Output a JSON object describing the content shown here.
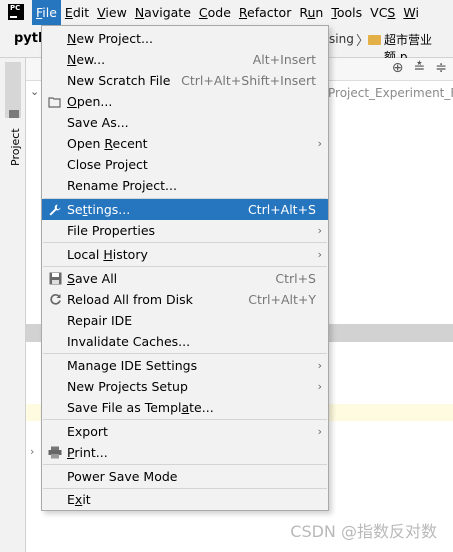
{
  "app_icon_text": "PC",
  "menubar": {
    "items": [
      {
        "pre": "",
        "u": "F",
        "post": "ile"
      },
      {
        "pre": "",
        "u": "E",
        "post": "dit"
      },
      {
        "pre": "",
        "u": "V",
        "post": "iew"
      },
      {
        "pre": "",
        "u": "N",
        "post": "avigate"
      },
      {
        "pre": "",
        "u": "C",
        "post": "ode"
      },
      {
        "pre": "",
        "u": "R",
        "post": "efactor"
      },
      {
        "pre": "R",
        "u": "u",
        "post": "n"
      },
      {
        "pre": "",
        "u": "T",
        "post": "ools"
      },
      {
        "pre": "VC",
        "u": "S",
        "post": ""
      },
      {
        "pre": "",
        "u": "W",
        "post": "i"
      }
    ]
  },
  "background": {
    "project_name": "pyth",
    "breadcrumb_fragment": "sing",
    "breadcrumb_folder": "超市营业额.p",
    "tree_path_tail": "Project_Experiment_Fir",
    "project_tab_label": "Project",
    "watermark": "CSDN @指数反对数"
  },
  "file_menu": {
    "items": [
      {
        "pre": "",
        "u": "N",
        "post": "ew Project...",
        "shortcut": "",
        "icon": ""
      },
      {
        "pre": "",
        "u": "N",
        "post": "ew...",
        "shortcut": "Alt+Insert",
        "icon": ""
      },
      {
        "pre": "New Scratch File",
        "u": "",
        "post": "",
        "shortcut": "Ctrl+Alt+Shift+Insert",
        "icon": ""
      },
      {
        "pre": "",
        "u": "O",
        "post": "pen...",
        "shortcut": "",
        "icon": "folder-open-icon"
      },
      {
        "pre": "Save As...",
        "u": "",
        "post": "",
        "shortcut": "",
        "icon": ""
      },
      {
        "pre": "Open ",
        "u": "R",
        "post": "ecent",
        "shortcut": "",
        "icon": ""
      },
      {
        "pre": "Close Project",
        "u": "",
        "post": "",
        "shortcut": "",
        "icon": ""
      },
      {
        "pre": "Rename Project...",
        "u": "",
        "post": "",
        "shortcut": "",
        "icon": ""
      },
      {
        "pre": "Se",
        "u": "t",
        "post": "tings...",
        "shortcut": "Ctrl+Alt+S",
        "icon": "wrench-icon"
      },
      {
        "pre": "File Properties",
        "u": "",
        "post": "",
        "shortcut": "",
        "icon": ""
      },
      {
        "pre": "Local ",
        "u": "H",
        "post": "istory",
        "shortcut": "",
        "icon": ""
      },
      {
        "pre": "",
        "u": "S",
        "post": "ave All",
        "shortcut": "Ctrl+S",
        "icon": "save-icon"
      },
      {
        "pre": "Reload All from Disk",
        "u": "",
        "post": "",
        "shortcut": "Ctrl+Alt+Y",
        "icon": "reload-icon"
      },
      {
        "pre": "Repair IDE",
        "u": "",
        "post": "",
        "shortcut": "",
        "icon": ""
      },
      {
        "pre": "Invalidate Caches...",
        "u": "",
        "post": "",
        "shortcut": "",
        "icon": ""
      },
      {
        "pre": "Manage IDE Settings",
        "u": "",
        "post": "",
        "shortcut": "",
        "icon": ""
      },
      {
        "pre": "New Projects Setup",
        "u": "",
        "post": "",
        "shortcut": "",
        "icon": ""
      },
      {
        "pre": "Save File as Templ",
        "u": "a",
        "post": "te...",
        "shortcut": "",
        "icon": ""
      },
      {
        "pre": "Export",
        "u": "",
        "post": "",
        "shortcut": "",
        "icon": ""
      },
      {
        "pre": "",
        "u": "P",
        "post": "rint...",
        "shortcut": "",
        "icon": "printer-icon"
      },
      {
        "pre": "Power Save Mode",
        "u": "",
        "post": "",
        "shortcut": "",
        "icon": ""
      },
      {
        "pre": "E",
        "u": "x",
        "post": "it",
        "shortcut": "",
        "icon": ""
      }
    ]
  },
  "colors": {
    "menu_highlight": "#2675bf",
    "menu_background": "#f2f2f2"
  }
}
